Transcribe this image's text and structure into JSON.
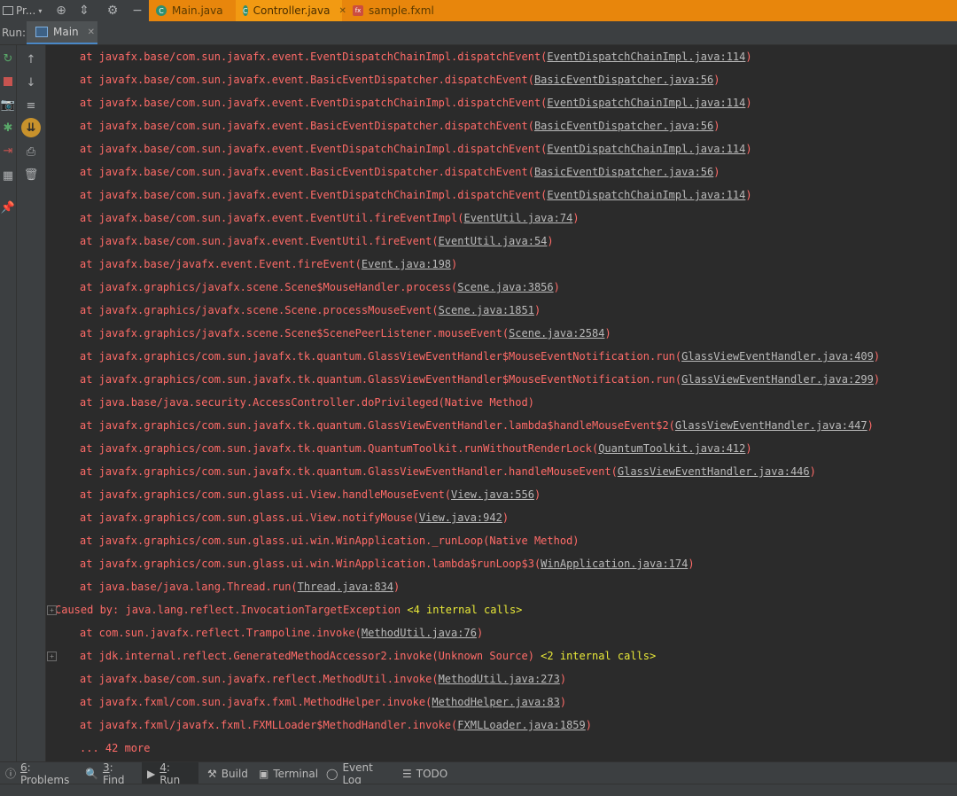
{
  "title_bar": {
    "project_label": "Pr...",
    "tabs": [
      {
        "label": "Main.java",
        "badge": "C"
      },
      {
        "label": "Controller.java",
        "badge": "C"
      },
      {
        "label": "sample.fxml",
        "badge": "fx"
      }
    ]
  },
  "run_panel": {
    "label": "Run:",
    "tab_label": "Main"
  },
  "console": {
    "lines": [
      {
        "pre": "at javafx.base/com.sun.javafx.event.EventDispatchChainImpl.dispatchEvent(",
        "link": "EventDispatchChainImpl.java:114",
        "post": ")"
      },
      {
        "pre": "at javafx.base/com.sun.javafx.event.BasicEventDispatcher.dispatchEvent(",
        "link": "BasicEventDispatcher.java:56",
        "post": ")"
      },
      {
        "pre": "at javafx.base/com.sun.javafx.event.EventDispatchChainImpl.dispatchEvent(",
        "link": "EventDispatchChainImpl.java:114",
        "post": ")"
      },
      {
        "pre": "at javafx.base/com.sun.javafx.event.BasicEventDispatcher.dispatchEvent(",
        "link": "BasicEventDispatcher.java:56",
        "post": ")"
      },
      {
        "pre": "at javafx.base/com.sun.javafx.event.EventDispatchChainImpl.dispatchEvent(",
        "link": "EventDispatchChainImpl.java:114",
        "post": ")"
      },
      {
        "pre": "at javafx.base/com.sun.javafx.event.BasicEventDispatcher.dispatchEvent(",
        "link": "BasicEventDispatcher.java:56",
        "post": ")"
      },
      {
        "pre": "at javafx.base/com.sun.javafx.event.EventDispatchChainImpl.dispatchEvent(",
        "link": "EventDispatchChainImpl.java:114",
        "post": ")"
      },
      {
        "pre": "at javafx.base/com.sun.javafx.event.EventUtil.fireEventImpl(",
        "link": "EventUtil.java:74",
        "post": ")"
      },
      {
        "pre": "at javafx.base/com.sun.javafx.event.EventUtil.fireEvent(",
        "link": "EventUtil.java:54",
        "post": ")"
      },
      {
        "pre": "at javafx.base/javafx.event.Event.fireEvent(",
        "link": "Event.java:198",
        "post": ")"
      },
      {
        "pre": "at javafx.graphics/javafx.scene.Scene$MouseHandler.process(",
        "link": "Scene.java:3856",
        "post": ")"
      },
      {
        "pre": "at javafx.graphics/javafx.scene.Scene.processMouseEvent(",
        "link": "Scene.java:1851",
        "post": ")"
      },
      {
        "pre": "at javafx.graphics/javafx.scene.Scene$ScenePeerListener.mouseEvent(",
        "link": "Scene.java:2584",
        "post": ")"
      },
      {
        "pre": "at javafx.graphics/com.sun.javafx.tk.quantum.GlassViewEventHandler$MouseEventNotification.run(",
        "link": "GlassViewEventHandler.java:409",
        "post": ")"
      },
      {
        "pre": "at javafx.graphics/com.sun.javafx.tk.quantum.GlassViewEventHandler$MouseEventNotification.run(",
        "link": "GlassViewEventHandler.java:299",
        "post": ")"
      },
      {
        "pre": "at java.base/java.security.AccessController.doPrivileged(Native Method)",
        "link": "",
        "post": ""
      },
      {
        "pre": "at javafx.graphics/com.sun.javafx.tk.quantum.GlassViewEventHandler.lambda$handleMouseEvent$2(",
        "link": "GlassViewEventHandler.java:447",
        "post": ")"
      },
      {
        "pre": "at javafx.graphics/com.sun.javafx.tk.quantum.QuantumToolkit.runWithoutRenderLock(",
        "link": "QuantumToolkit.java:412",
        "post": ")"
      },
      {
        "pre": "at javafx.graphics/com.sun.javafx.tk.quantum.GlassViewEventHandler.handleMouseEvent(",
        "link": "GlassViewEventHandler.java:446",
        "post": ")"
      },
      {
        "pre": "at javafx.graphics/com.sun.glass.ui.View.handleMouseEvent(",
        "link": "View.java:556",
        "post": ")"
      },
      {
        "pre": "at javafx.graphics/com.sun.glass.ui.View.notifyMouse(",
        "link": "View.java:942",
        "post": ")"
      },
      {
        "pre": "at javafx.graphics/com.sun.glass.ui.win.WinApplication._runLoop(Native Method)",
        "link": "",
        "post": ""
      },
      {
        "pre": "at javafx.graphics/com.sun.glass.ui.win.WinApplication.lambda$runLoop$3(",
        "link": "WinApplication.java:174",
        "post": ")"
      },
      {
        "pre": "at java.base/java.lang.Thread.run(",
        "link": "Thread.java:834",
        "post": ")"
      },
      {
        "pre": "Caused by: java.lang.reflect.InvocationTargetException ",
        "link": "",
        "post": "",
        "internal": "<4 internal calls>",
        "outdent": true,
        "fold": true
      },
      {
        "pre": "at com.sun.javafx.reflect.Trampoline.invoke(",
        "link": "MethodUtil.java:76",
        "post": ")"
      },
      {
        "pre": "at jdk.internal.reflect.GeneratedMethodAccessor2.invoke(Unknown Source) ",
        "link": "",
        "post": "",
        "internal": "<2 internal calls>",
        "fold": true
      },
      {
        "pre": "at javafx.base/com.sun.javafx.reflect.MethodUtil.invoke(",
        "link": "MethodUtil.java:273",
        "post": ")"
      },
      {
        "pre": "at javafx.fxml/com.sun.javafx.fxml.MethodHelper.invoke(",
        "link": "MethodHelper.java:83",
        "post": ")"
      },
      {
        "pre": "at javafx.fxml/javafx.fxml.FXMLLoader$MethodHandler.invoke(",
        "link": "FXMLLoader.java:1859",
        "post": ")"
      },
      {
        "pre": "... 42 more",
        "link": "",
        "post": ""
      }
    ]
  },
  "bottom_tools": [
    {
      "key": "6",
      "label": ": Problems",
      "icon": "problems-icon"
    },
    {
      "key": "3",
      "label": ": Find",
      "icon": "search-icon"
    },
    {
      "key": "4",
      "label": ": Run",
      "icon": "run-icon",
      "active": true
    },
    {
      "key": "",
      "label": "Build",
      "icon": "build-icon"
    },
    {
      "key": "",
      "label": "Terminal",
      "icon": "terminal-icon"
    },
    {
      "key": "",
      "label": "Event Log",
      "icon": "event-log-icon"
    },
    {
      "key": "",
      "label": "TODO",
      "icon": "todo-icon"
    }
  ],
  "colors": {
    "error_text": "#ff6b68",
    "link_text": "#bbbbbb",
    "internal_calls": "#e8e838",
    "tab_strip": "#e8860c",
    "console_bg": "#2b2b2b"
  }
}
